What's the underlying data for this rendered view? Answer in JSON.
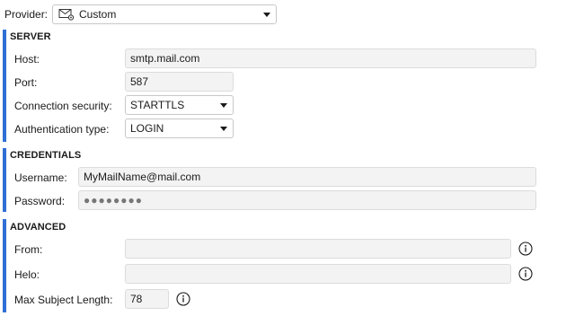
{
  "provider": {
    "label": "Provider:",
    "value": "Custom",
    "icon": "envelope-gear-icon"
  },
  "server": {
    "title": "SERVER",
    "host_label": "Host:",
    "host_value": "smtp.mail.com",
    "port_label": "Port:",
    "port_value": "587",
    "security_label": "Connection security:",
    "security_value": "STARTTLS",
    "auth_label": "Authentication type:",
    "auth_value": "LOGIN"
  },
  "credentials": {
    "title": "CREDENTIALS",
    "username_label": "Username:",
    "username_value": "MyMailName@mail.com",
    "password_label": "Password:",
    "password_value": "●●●●●●●●"
  },
  "advanced": {
    "title": "ADVANCED",
    "from_label": "From:",
    "from_value": "",
    "helo_label": "Helo:",
    "helo_value": "",
    "max_subject_label": "Max Subject Length:",
    "max_subject_value": "78"
  },
  "colors": {
    "accent": "#2f6fd6"
  }
}
